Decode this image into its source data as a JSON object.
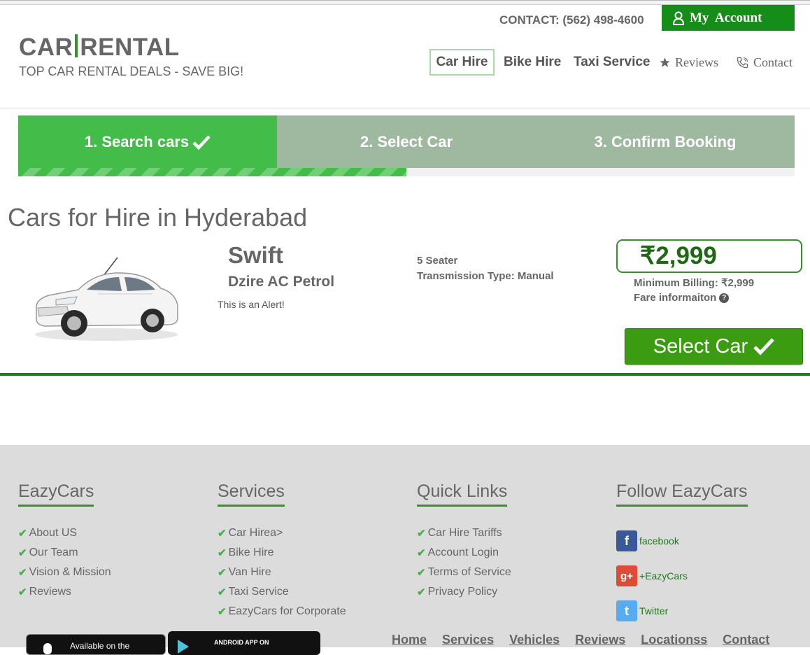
{
  "header": {
    "logo_left": "CAR",
    "logo_right": "RENTAL",
    "tagline": "TOP CAR RENTAL DEALS - SAVE BIG!",
    "contact": "CONTACT: (562) 498-4600",
    "account_label": "My  Account",
    "nav": {
      "car_hire": "Car Hire",
      "bike_hire": "Bike Hire",
      "taxi_service": "Taxi Service",
      "reviews": "Reviews",
      "contact": "Contact"
    }
  },
  "steps": {
    "step1": "1. Search cars",
    "step2": "2. Select Car",
    "step3": "3. Confirm Booking",
    "progress_fraction": 0.5
  },
  "main": {
    "title": "Cars for Hire in Hyderabad",
    "car": {
      "name": "Swift",
      "variant": "Dzire AC Petrol",
      "alert": "This is an Alert!",
      "seats": "5 Seater",
      "transmission": "Transmission Type: Manual",
      "price": "₹2,999",
      "min_billing": "Minimum Billing: ₹2,999",
      "fare_info": "Fare informaiton",
      "select_label": "Select Car"
    }
  },
  "footer": {
    "eazycars": {
      "heading": "EazyCars",
      "items": [
        "About US",
        "Our Team",
        "Vision & Mission",
        "Reviews"
      ]
    },
    "services": {
      "heading": "Services",
      "items": [
        "Car Hirea>",
        "Bike Hire",
        "Van Hire",
        "Taxi Service",
        "EazyCars for Corporate"
      ]
    },
    "quick_links": {
      "heading": "Quick Links",
      "items": [
        "Car Hire Tariffs",
        "Account Login",
        "Terms of Service",
        "Privacy Policy"
      ]
    },
    "follow": {
      "heading": "Follow EazyCars",
      "facebook": "facebook",
      "google": "+EazyCars",
      "twitter": "Twitter"
    },
    "appstore": "Available on the",
    "googleplay": "ANDROID APP ON",
    "bottom_nav": [
      "Home",
      "Services",
      "Vehicles",
      "Reviews",
      "Locationss",
      "Contact"
    ]
  },
  "colors": {
    "accent_green": "#43bc4a",
    "dark_green": "#158e19",
    "step_inactive": "#9fb9a1",
    "footer_bg": "#dcdcdc"
  }
}
